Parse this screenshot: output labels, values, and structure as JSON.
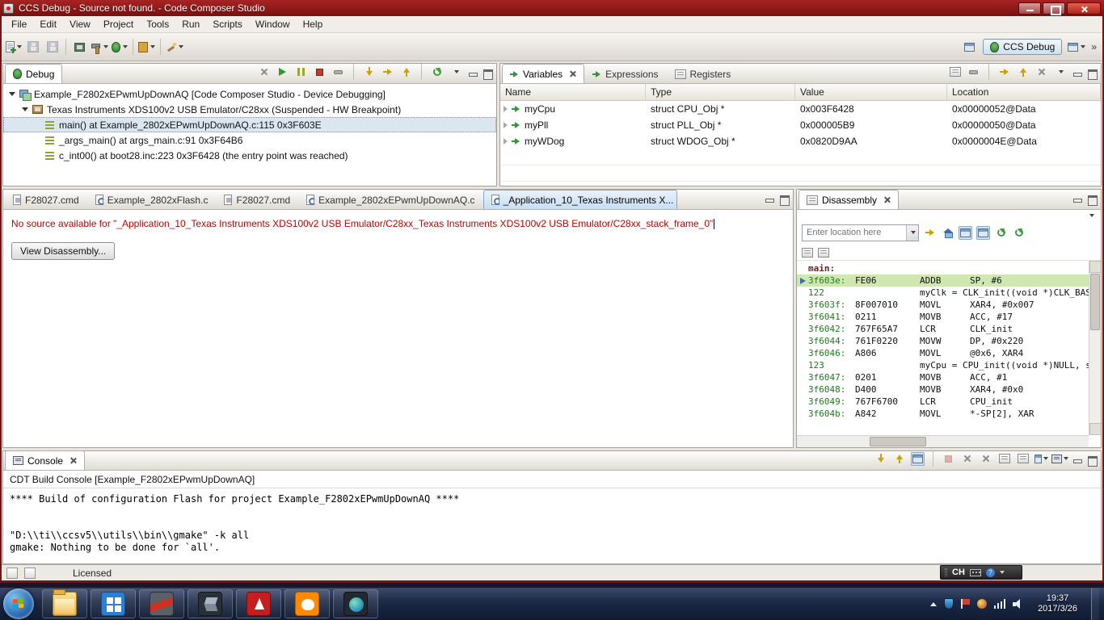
{
  "window": {
    "title": "CCS Debug - Source not found. - Code Composer Studio"
  },
  "menu": [
    "File",
    "Edit",
    "View",
    "Project",
    "Tools",
    "Run",
    "Scripts",
    "Window",
    "Help"
  ],
  "toolbar": {
    "perspective_label": "CCS Debug"
  },
  "icons": {
    "help": "?",
    "overflow": "»"
  },
  "debug_panel": {
    "tab": "Debug",
    "tree": [
      {
        "label": "Example_F2802xEPwmUpDownAQ [Code Composer Studio - Device Debugging]"
      },
      {
        "label": "Texas Instruments XDS100v2 USB Emulator/C28xx (Suspended - HW Breakpoint)"
      },
      {
        "label": "main() at Example_2802xEPwmUpDownAQ.c:115 0x3F603E"
      },
      {
        "label": "_args_main() at args_main.c:91 0x3F64B6"
      },
      {
        "label": "c_int00() at boot28.inc:223 0x3F6428  (the entry point was reached)"
      }
    ]
  },
  "variables_panel": {
    "tabs": [
      "Variables",
      "Expressions",
      "Registers"
    ],
    "columns": [
      "Name",
      "Type",
      "Value",
      "Location"
    ],
    "rows": [
      {
        "name": "myCpu",
        "type": "struct CPU_Obj *",
        "value": "0x003F6428",
        "location": "0x00000052@Data"
      },
      {
        "name": "myPll",
        "type": "struct PLL_Obj *",
        "value": "0x000005B9",
        "location": "0x00000050@Data"
      },
      {
        "name": "myWDog",
        "type": "struct WDOG_Obj *",
        "value": "0x0820D9AA",
        "location": "0x0000004E@Data"
      }
    ]
  },
  "editor": {
    "tabs": [
      {
        "label": "F28027.cmd"
      },
      {
        "label": "Example_2802xFlash.c"
      },
      {
        "label": "F28027.cmd"
      },
      {
        "label": "Example_2802xEPwmUpDownAQ.c"
      },
      {
        "label": "_Application_10_Texas Instruments X..."
      }
    ],
    "message": "No source available for \"_Application_10_Texas Instruments XDS100v2 USB Emulator/C28xx_Texas Instruments XDS100v2 USB Emulator/C28xx_stack_frame_0\"",
    "view_disassembly_button": "View Disassembly..."
  },
  "disassembly": {
    "tab": "Disassembly",
    "location_placeholder": "Enter location here",
    "lines": [
      {
        "label": "main:"
      },
      {
        "addr": "3f603e:",
        "code": "FE06",
        "op": "ADDB",
        "args": "SP, #6"
      },
      {
        "num": "122",
        "src": "myClk = CLK_init((void *)CLK_BASE_A"
      },
      {
        "addr": "3f603f:",
        "code": "8F007010",
        "op": "MOVL",
        "args": "XAR4, #0x007"
      },
      {
        "addr": "3f6041:",
        "code": "0211",
        "op": "MOVB",
        "args": "ACC, #17"
      },
      {
        "addr": "3f6042:",
        "code": "767F65A7",
        "op": "LCR",
        "args": "CLK_init"
      },
      {
        "addr": "3f6044:",
        "code": "761F0220",
        "op": "MOVW",
        "args": "DP, #0x220"
      },
      {
        "addr": "3f6046:",
        "code": "A806",
        "op": "MOVL",
        "args": "@0x6, XAR4"
      },
      {
        "num": "123",
        "src": "myCpu = CPU_init((void *)NULL, size"
      },
      {
        "addr": "3f6047:",
        "code": "0201",
        "op": "MOVB",
        "args": "ACC, #1"
      },
      {
        "addr": "3f6048:",
        "code": "D400",
        "op": "MOVB",
        "args": "XAR4, #0x0"
      },
      {
        "addr": "3f6049:",
        "code": "767F6700",
        "op": "LCR",
        "args": "CPU_init"
      },
      {
        "addr": "3f604b:",
        "code": "A842",
        "op": "MOVL",
        "args": "*-SP[2], XAR"
      }
    ]
  },
  "console_panel": {
    "tab": "Console",
    "header": "CDT Build Console [Example_F2802xEPwmUpDownAQ]",
    "lines": [
      "**** Build of configuration Flash for project Example_F2802xEPwmUpDownAQ ****",
      "",
      "\"D:\\\\ti\\\\ccsv5\\\\utils\\\\bin\\\\gmake\" -k all",
      "gmake: Nothing to be done for `all'."
    ]
  },
  "statusbar": {
    "license": "Licensed"
  },
  "langbar": {
    "ime": "CH"
  },
  "taskbar": {
    "time": "19:37",
    "date": "2017/3/26"
  }
}
